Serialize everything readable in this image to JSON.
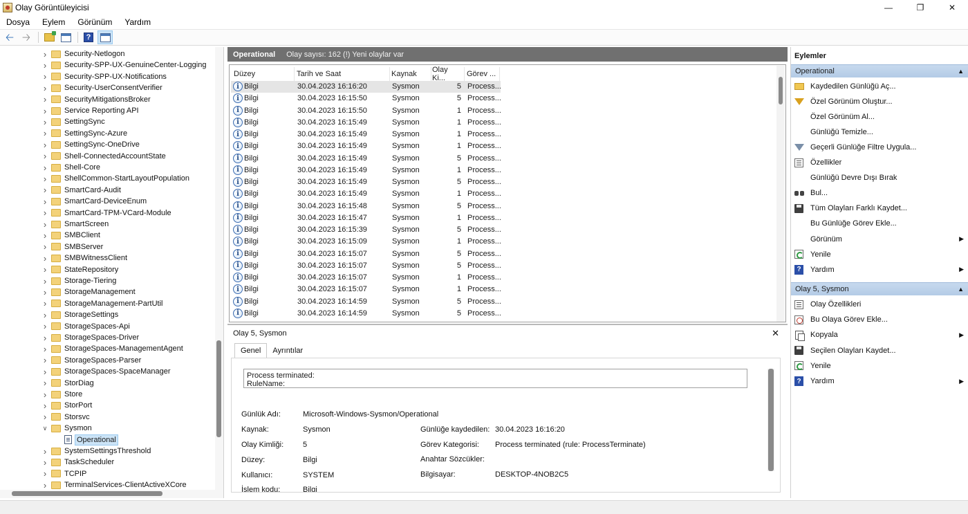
{
  "window": {
    "title": "Olay Görüntüleyicisi",
    "minimize": "—",
    "restore": "❐",
    "close": "✕"
  },
  "menu": [
    "Dosya",
    "Eylem",
    "Görünüm",
    "Yardım"
  ],
  "tree": {
    "items": [
      "Security-Netlogon",
      "Security-SPP-UX-GenuineCenter-Logging",
      "Security-SPP-UX-Notifications",
      "Security-UserConsentVerifier",
      "SecurityMitigationsBroker",
      "Service Reporting API",
      "SettingSync",
      "SettingSync-Azure",
      "SettingSync-OneDrive",
      "Shell-ConnectedAccountState",
      "Shell-Core",
      "ShellCommon-StartLayoutPopulation",
      "SmartCard-Audit",
      "SmartCard-DeviceEnum",
      "SmartCard-TPM-VCard-Module",
      "SmartScreen",
      "SMBClient",
      "SMBServer",
      "SMBWitnessClient",
      "StateRepository",
      "Storage-Tiering",
      "StorageManagement",
      "StorageManagement-PartUtil",
      "StorageSettings",
      "StorageSpaces-Api",
      "StorageSpaces-Driver",
      "StorageSpaces-ManagementAgent",
      "StorageSpaces-Parser",
      "StorageSpaces-SpaceManager",
      "StorDiag",
      "Store",
      "StorPort",
      "Storsvc",
      "Sysmon"
    ],
    "selected_child": "Operational",
    "items_after": [
      "SystemSettingsThreshold",
      "TaskScheduler",
      "TCPIP",
      "TerminalServices-ClientActiveXCore"
    ]
  },
  "events_panel": {
    "title": "Operational",
    "count_text": "Olay sayısı: 162 (!) Yeni olaylar var",
    "columns": [
      "Düzey",
      "Tarih ve Saat",
      "Kaynak",
      "Olay Ki...",
      "Görev ..."
    ],
    "rows": [
      [
        "Bilgi",
        "30.04.2023 16:16:20",
        "Sysmon",
        "5",
        "Process..."
      ],
      [
        "Bilgi",
        "30.04.2023 16:15:50",
        "Sysmon",
        "5",
        "Process..."
      ],
      [
        "Bilgi",
        "30.04.2023 16:15:50",
        "Sysmon",
        "1",
        "Process..."
      ],
      [
        "Bilgi",
        "30.04.2023 16:15:49",
        "Sysmon",
        "1",
        "Process..."
      ],
      [
        "Bilgi",
        "30.04.2023 16:15:49",
        "Sysmon",
        "1",
        "Process..."
      ],
      [
        "Bilgi",
        "30.04.2023 16:15:49",
        "Sysmon",
        "1",
        "Process..."
      ],
      [
        "Bilgi",
        "30.04.2023 16:15:49",
        "Sysmon",
        "5",
        "Process..."
      ],
      [
        "Bilgi",
        "30.04.2023 16:15:49",
        "Sysmon",
        "1",
        "Process..."
      ],
      [
        "Bilgi",
        "30.04.2023 16:15:49",
        "Sysmon",
        "5",
        "Process..."
      ],
      [
        "Bilgi",
        "30.04.2023 16:15:49",
        "Sysmon",
        "1",
        "Process..."
      ],
      [
        "Bilgi",
        "30.04.2023 16:15:48",
        "Sysmon",
        "5",
        "Process..."
      ],
      [
        "Bilgi",
        "30.04.2023 16:15:47",
        "Sysmon",
        "1",
        "Process..."
      ],
      [
        "Bilgi",
        "30.04.2023 16:15:39",
        "Sysmon",
        "5",
        "Process..."
      ],
      [
        "Bilgi",
        "30.04.2023 16:15:09",
        "Sysmon",
        "1",
        "Process..."
      ],
      [
        "Bilgi",
        "30.04.2023 16:15:07",
        "Sysmon",
        "5",
        "Process..."
      ],
      [
        "Bilgi",
        "30.04.2023 16:15:07",
        "Sysmon",
        "5",
        "Process..."
      ],
      [
        "Bilgi",
        "30.04.2023 16:15:07",
        "Sysmon",
        "1",
        "Process..."
      ],
      [
        "Bilgi",
        "30.04.2023 16:15:07",
        "Sysmon",
        "1",
        "Process..."
      ],
      [
        "Bilgi",
        "30.04.2023 16:14:59",
        "Sysmon",
        "5",
        "Process..."
      ],
      [
        "Bilgi",
        "30.04.2023 16:14:59",
        "Sysmon",
        "5",
        "Process..."
      ]
    ]
  },
  "detail": {
    "title": "Olay 5, Sysmon",
    "close": "✕",
    "tabs": [
      "Genel",
      "Ayrıntılar"
    ],
    "description_lines": [
      "Process terminated:",
      "RuleName:"
    ],
    "fields": {
      "log_name_label": "Günlük Adı:",
      "log_name_value": "Microsoft-Windows-Sysmon/Operational",
      "source_label": "Kaynak:",
      "source_value": "Sysmon",
      "logged_label": "Günlüğe kaydedilen:",
      "logged_value": "30.04.2023 16:16:20",
      "event_id_label": "Olay Kimliği:",
      "event_id_value": "5",
      "task_label": "Görev Kategorisi:",
      "task_value": "Process terminated (rule: ProcessTerminate)",
      "level_label": "Düzey:",
      "level_value": "Bilgi",
      "keywords_label": "Anahtar Sözcükler:",
      "user_label": "Kullanıcı:",
      "user_value": "SYSTEM",
      "computer_label": "Bilgisayar:",
      "computer_value": "DESKTOP-4NOB2C5",
      "opcode_label": "İşlem kodu:",
      "opcode_value": "Bilgi"
    }
  },
  "actions": {
    "title": "Eylemler",
    "section1": {
      "label": "Operational",
      "items": [
        {
          "label": "Kaydedilen Günlüğü Aç...",
          "icon": "open-folder-icon"
        },
        {
          "label": "Özel Görünüm Oluştur...",
          "icon": "funnel-icon"
        },
        {
          "label": "Özel Görünüm Al...",
          "icon": ""
        },
        {
          "label": "Günlüğü Temizle...",
          "icon": ""
        },
        {
          "label": "Geçerli Günlüğe Filtre Uygula...",
          "icon": "filter-icon"
        },
        {
          "label": "Özellikler",
          "icon": "properties-icon"
        },
        {
          "label": "Günlüğü Devre Dışı Bırak",
          "icon": ""
        },
        {
          "label": "Bul...",
          "icon": "binoculars-icon"
        },
        {
          "label": "Tüm Olayları Farklı Kaydet...",
          "icon": "save-icon"
        },
        {
          "label": "Bu Günlüğe Görev Ekle...",
          "icon": ""
        },
        {
          "label": "Görünüm",
          "icon": "",
          "submenu": true
        },
        {
          "label": "Yenile",
          "icon": "refresh-icon"
        },
        {
          "label": "Yardım",
          "icon": "help-icon",
          "submenu": true
        }
      ]
    },
    "section2": {
      "label": "Olay 5, Sysmon",
      "items": [
        {
          "label": "Olay Özellikleri",
          "icon": "properties-icon"
        },
        {
          "label": "Bu Olaya Görev Ekle...",
          "icon": "task-icon"
        },
        {
          "label": "Kopyala",
          "icon": "copy-icon",
          "submenu": true
        },
        {
          "label": "Seçilen Olayları Kaydet...",
          "icon": "save-icon"
        },
        {
          "label": "Yenile",
          "icon": "refresh-icon"
        },
        {
          "label": "Yardım",
          "icon": "help-icon",
          "submenu": true
        }
      ]
    }
  },
  "colors": {
    "panel_header": "#707070",
    "section_header": "#c7d9ee",
    "selection": "#cce4f7"
  }
}
